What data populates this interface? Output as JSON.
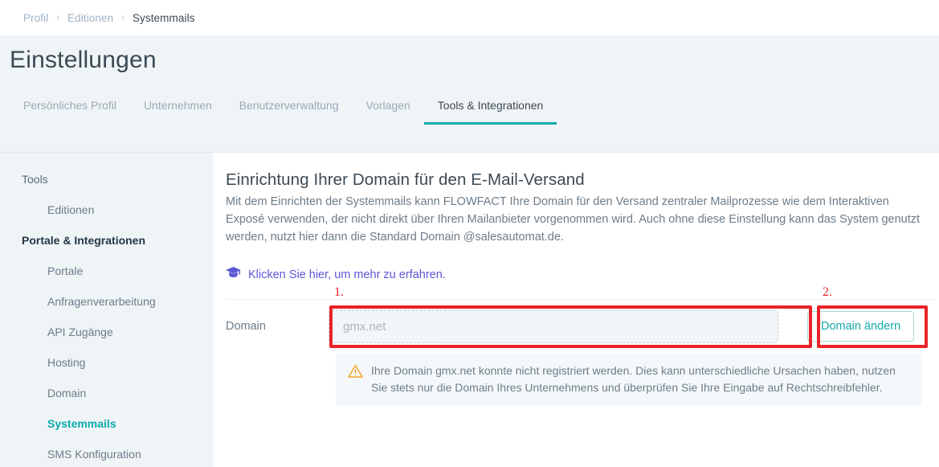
{
  "breadcrumb": {
    "items": [
      {
        "label": "Profil",
        "active": false
      },
      {
        "label": "Editionen",
        "active": false
      },
      {
        "label": "Systemmails",
        "active": true
      }
    ],
    "separator": "›"
  },
  "header": {
    "title": "Einstellungen",
    "tabs": [
      {
        "label": "Persönliches Profil",
        "active": false
      },
      {
        "label": "Unternehmen",
        "active": false
      },
      {
        "label": "Benutzerverwaltung",
        "active": false
      },
      {
        "label": "Vorlagen",
        "active": false
      },
      {
        "label": "Tools & Integrationen",
        "active": true
      }
    ]
  },
  "sidebar": {
    "entries": [
      {
        "label": "Tools",
        "type": "group",
        "bold": false,
        "active": false
      },
      {
        "label": "Editionen",
        "type": "item",
        "bold": false,
        "active": false
      },
      {
        "label": "Portale & Integrationen",
        "type": "group",
        "bold": true,
        "active": false
      },
      {
        "label": "Portale",
        "type": "item",
        "bold": false,
        "active": false
      },
      {
        "label": "Anfragenverarbeitung",
        "type": "item",
        "bold": false,
        "active": false
      },
      {
        "label": "API Zugänge",
        "type": "item",
        "bold": false,
        "active": false
      },
      {
        "label": "Hosting",
        "type": "item",
        "bold": false,
        "active": false
      },
      {
        "label": "Domain",
        "type": "item",
        "bold": false,
        "active": false
      },
      {
        "label": "Systemmails",
        "type": "item",
        "bold": false,
        "active": true
      },
      {
        "label": "SMS Konfiguration",
        "type": "item",
        "bold": false,
        "active": false
      }
    ]
  },
  "content": {
    "heading": "Einrichtung Ihrer Domain für den E-Mail-Versand",
    "paragraph": "Mit dem Einrichten der Systemmails kann FLOWFACT Ihre Domain für den Versand zentraler Mailprozesse wie dem Interaktiven Exposé verwenden, der nicht direkt über Ihren Mailanbieter vorgenommen wird. Auch ohne diese Einstellung kann das System genutzt werden, nutzt hier dann die Standard Domain @salesautomat.de.",
    "learn_more_link": "Klicken Sie hier, um mehr zu erfahren.",
    "learn_more_icon": "graduation-cap-icon",
    "form": {
      "domain_label": "Domain",
      "domain_value": "",
      "domain_placeholder": "gmx.net",
      "change_button": "Domain ändern"
    },
    "warning": {
      "icon": "warning-triangle-icon",
      "message": "Ihre Domain gmx.net konnte nicht registriert werden. Dies kann unterschiedliche Ursachen haben, nutzen Sie stets nur die Domain Ihres Unternehmens und überprüfen Sie Ihre Eingabe auf Rechtschreibfehler."
    }
  },
  "annotations": [
    {
      "number": "1.",
      "target": "domain-input"
    },
    {
      "number": "2.",
      "target": "change-domain-button"
    }
  ],
  "colors": {
    "accent_teal": "#0aabab",
    "link_purple": "#5b57d6",
    "annotation_red": "#e8242a",
    "warning_orange": "#f5a623",
    "header_bg": "#eff4f7",
    "content_bg": "#ffffff"
  }
}
